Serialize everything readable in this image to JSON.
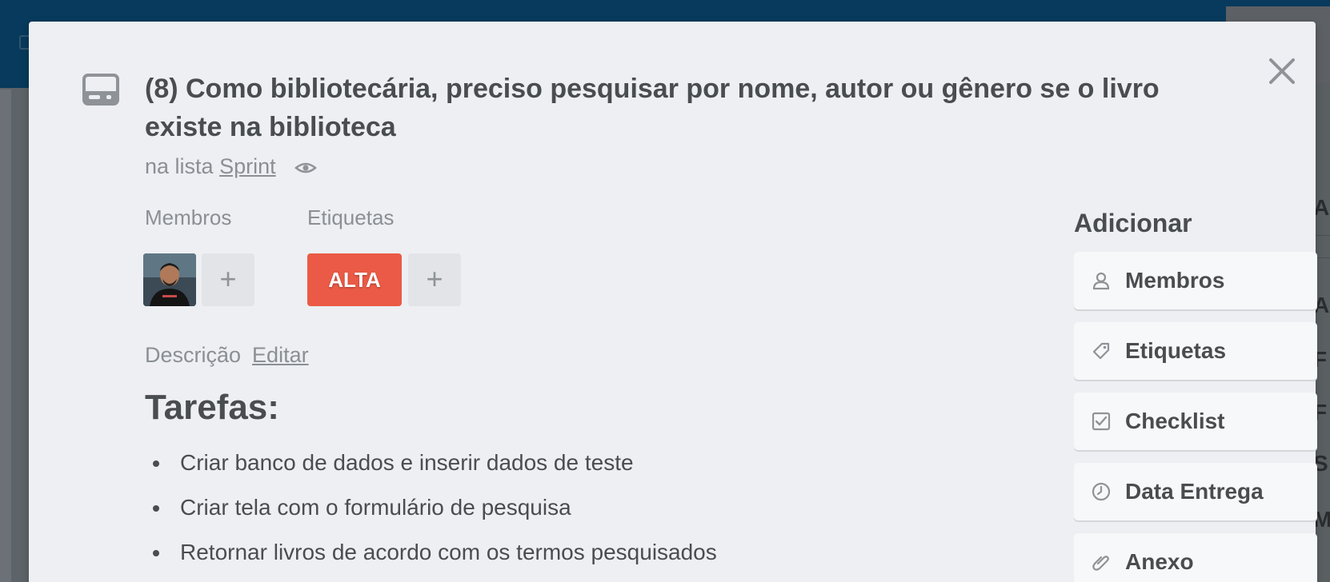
{
  "card": {
    "title": "(8) Como bibliotecária, preciso pesquisar por nome, autor ou gênero se o livro existe na biblioteca",
    "list_prefix": "na lista",
    "list_name": "Sprint"
  },
  "members": {
    "label": "Membros",
    "add_symbol": "+"
  },
  "labels": {
    "label": "Etiquetas",
    "items": [
      {
        "text": "ALTA",
        "color": "#eb5a46"
      }
    ],
    "add_symbol": "+"
  },
  "description": {
    "label": "Descrição",
    "edit_label": "Editar",
    "heading": "Tarefas:",
    "tasks": [
      "Criar banco de dados e inserir dados de teste",
      "Criar tela com o formulário de pesquisa",
      "Retornar livros de acordo com os termos pesquisados"
    ]
  },
  "sidebar": {
    "heading": "Adicionar",
    "buttons": [
      {
        "label": "Membros",
        "icon": "person-icon"
      },
      {
        "label": "Etiquetas",
        "icon": "tag-icon"
      },
      {
        "label": "Checklist",
        "icon": "checkbox-icon"
      },
      {
        "label": "Data Entrega",
        "icon": "clock-icon"
      },
      {
        "label": "Anexo",
        "icon": "paperclip-icon"
      }
    ]
  },
  "background": {
    "peek_letters": [
      "Ad",
      "A",
      "F",
      "F",
      "S",
      "M"
    ]
  }
}
